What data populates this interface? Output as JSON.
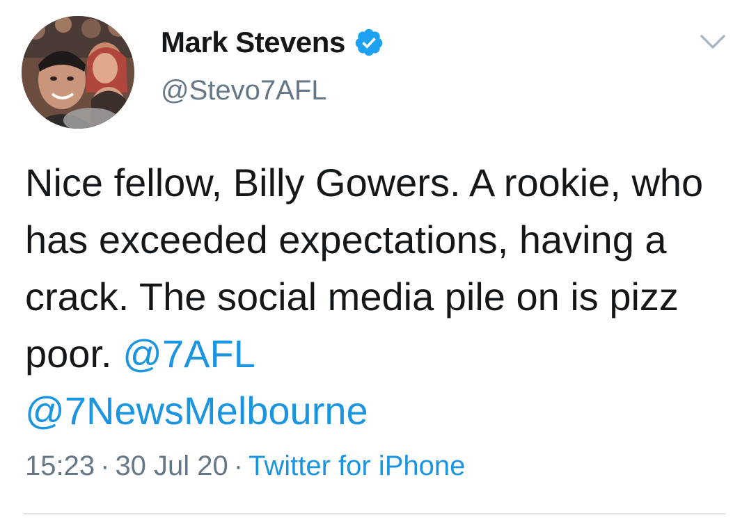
{
  "user": {
    "display_name": "Mark Stevens",
    "handle": "@Stevo7AFL",
    "verified": true,
    "avatar_icon": "profile-photo"
  },
  "tweet": {
    "text": "Nice fellow, Billy Gowers. A rookie, who has exceeded expectations, having a crack. The social media pile on is pizz poor. ",
    "mention_1": "@7AFL",
    "mention_2": "@7NewsMelbourne",
    "time": "15:23",
    "date": "30 Jul 20",
    "separator": "·",
    "source": "Twitter for iPhone"
  },
  "colors": {
    "link": "#1b95e0",
    "secondary_text": "#657786",
    "verified_badge": "#1da1f2",
    "divider": "#e1e8ed"
  },
  "icons": {
    "verified": "verified-badge-icon",
    "menu": "chevron-down-icon"
  }
}
